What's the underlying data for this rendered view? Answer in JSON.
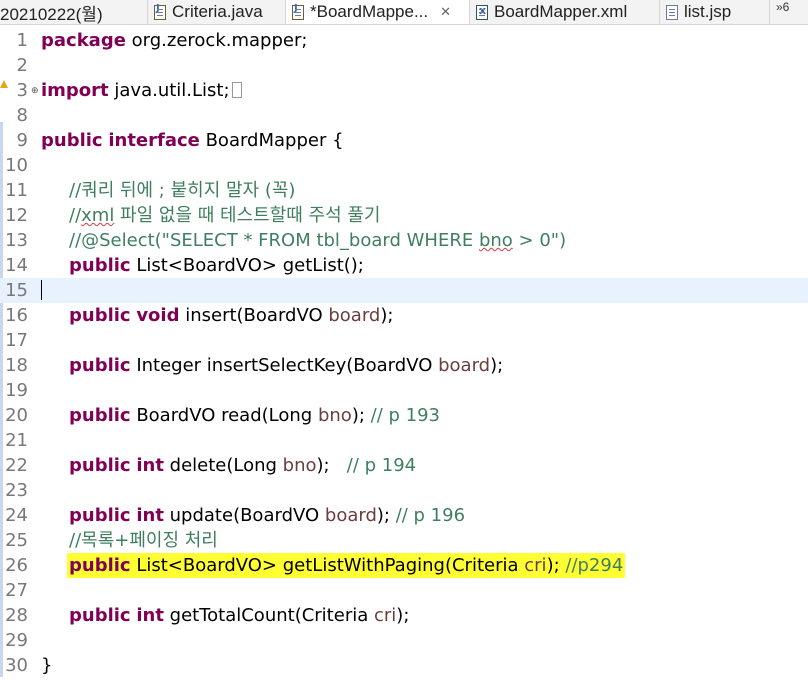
{
  "tabs": [
    {
      "label": "20210222(월)",
      "icon": "project-icon",
      "active": false
    },
    {
      "label": "Criteria.java",
      "icon": "java-file-icon",
      "active": false
    },
    {
      "label": "*BoardMappe...",
      "icon": "java-file-icon",
      "active": true,
      "close": "✕"
    },
    {
      "label": "BoardMapper.xml",
      "icon": "xml-file-icon",
      "active": false
    },
    {
      "label": "list.jsp",
      "icon": "jsp-file-icon",
      "active": false
    }
  ],
  "overflow_count": "»6",
  "editor": {
    "current_line": 15,
    "highlighted_line": 26,
    "lines": [
      {
        "num": "1",
        "text": "package org.zerock.mapper;"
      },
      {
        "num": "2",
        "text": ""
      },
      {
        "num": "3",
        "text": "import java.util.List;"
      },
      {
        "num": "8",
        "text": ""
      },
      {
        "num": "9",
        "text": "public interface BoardMapper {"
      },
      {
        "num": "10",
        "text": ""
      },
      {
        "num": "11",
        "text": "//쿼리 뒤에 ; 붙히지 말자 (꼭)"
      },
      {
        "num": "12",
        "text": "//xml 파일 없을 때 테스트할때 주석 풀기"
      },
      {
        "num": "13",
        "text": "//@Select(\"SELECT * FROM tbl_board WHERE bno > 0\")"
      },
      {
        "num": "14",
        "text": "public List<BoardVO> getList();"
      },
      {
        "num": "15",
        "text": ""
      },
      {
        "num": "16",
        "text": "public void insert(BoardVO board);"
      },
      {
        "num": "17",
        "text": ""
      },
      {
        "num": "18",
        "text": "public Integer insertSelectKey(BoardVO board);"
      },
      {
        "num": "19",
        "text": ""
      },
      {
        "num": "20",
        "text": "public BoardVO read(Long bno); // p 193"
      },
      {
        "num": "21",
        "text": ""
      },
      {
        "num": "22",
        "text": "public int delete(Long bno);   // p 194"
      },
      {
        "num": "23",
        "text": ""
      },
      {
        "num": "24",
        "text": "public int update(BoardVO board); // p 196"
      },
      {
        "num": "25",
        "text": "//목록+페이징 처리"
      },
      {
        "num": "26",
        "text": "public List<BoardVO> getListWithPaging(Criteria cri); //p294"
      },
      {
        "num": "27",
        "text": ""
      },
      {
        "num": "28",
        "text": "public int getTotalCount(Criteria cri);"
      },
      {
        "num": "29",
        "text": ""
      },
      {
        "num": "30",
        "text": "}"
      }
    ]
  }
}
